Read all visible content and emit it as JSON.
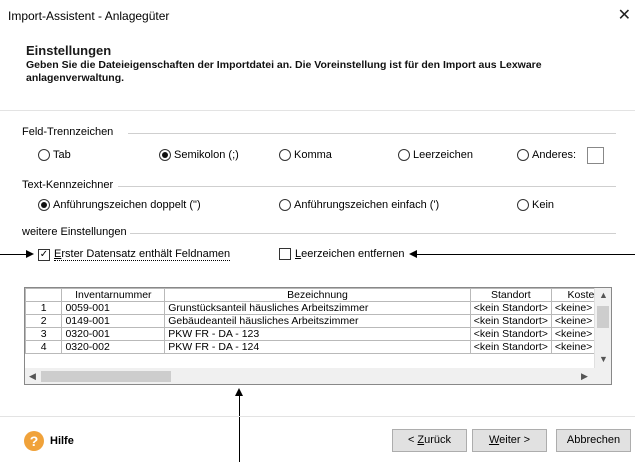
{
  "window": {
    "title": "Import-Assistent - Anlagegüter",
    "close_glyph": "✕"
  },
  "header": {
    "title": "Einstellungen",
    "description": "Geben Sie die Dateieigenschaften der Importdatei an. Die Voreinstellung ist für den Import aus Lexware anlagenverwaltung."
  },
  "field_separator": {
    "label": "Feld-Trennzeichen",
    "options": [
      {
        "label": "Tab",
        "checked": false
      },
      {
        "label": "Semikolon (;)",
        "checked": true
      },
      {
        "label": "Komma",
        "checked": false
      },
      {
        "label": "Leerzeichen",
        "checked": false
      },
      {
        "label": "Anderes:",
        "checked": false
      }
    ]
  },
  "text_qualifier": {
    "label": "Text-Kennzeichner",
    "options": [
      {
        "label": "Anführungszeichen doppelt (\")",
        "checked": true
      },
      {
        "label": "Anführungszeichen einfach (')",
        "checked": false
      },
      {
        "label": "Kein",
        "checked": false
      }
    ]
  },
  "more_settings": {
    "label": "weitere Einstellungen",
    "first_row_names": {
      "mnemonic": "E",
      "rest": "rster Datensatz enthält Feldnamen",
      "checked": true
    },
    "trim_spaces": {
      "mnemonic": "L",
      "rest": "eerzeichen entfernen",
      "checked": false
    }
  },
  "preview": {
    "columns": [
      "",
      "Inventarnummer",
      "Bezeichnung",
      "Standort",
      "Koste"
    ],
    "rows": [
      [
        "1",
        "0059-001",
        "Grunstücksanteil häusliches Arbeitszimmer",
        "<kein Standort>",
        "<keine>"
      ],
      [
        "2",
        "0149-001",
        "Gebäudeanteil häusliches Arbeitszimmer",
        "<kein Standort>",
        "<keine>"
      ],
      [
        "3",
        "0320-001",
        "PKW FR - DA - 123",
        "<kein Standort>",
        "<keine>"
      ],
      [
        "4",
        "0320-002",
        "PKW FR - DA - 124",
        "<kein Standort>",
        "<keine>"
      ]
    ]
  },
  "footer": {
    "help_label": "Hilfe",
    "back": {
      "prefix": "< ",
      "mnemonic": "Z",
      "rest": "urück"
    },
    "next": {
      "mnemonic": "W",
      "rest": "eiter >"
    },
    "cancel": "Abbrechen"
  }
}
